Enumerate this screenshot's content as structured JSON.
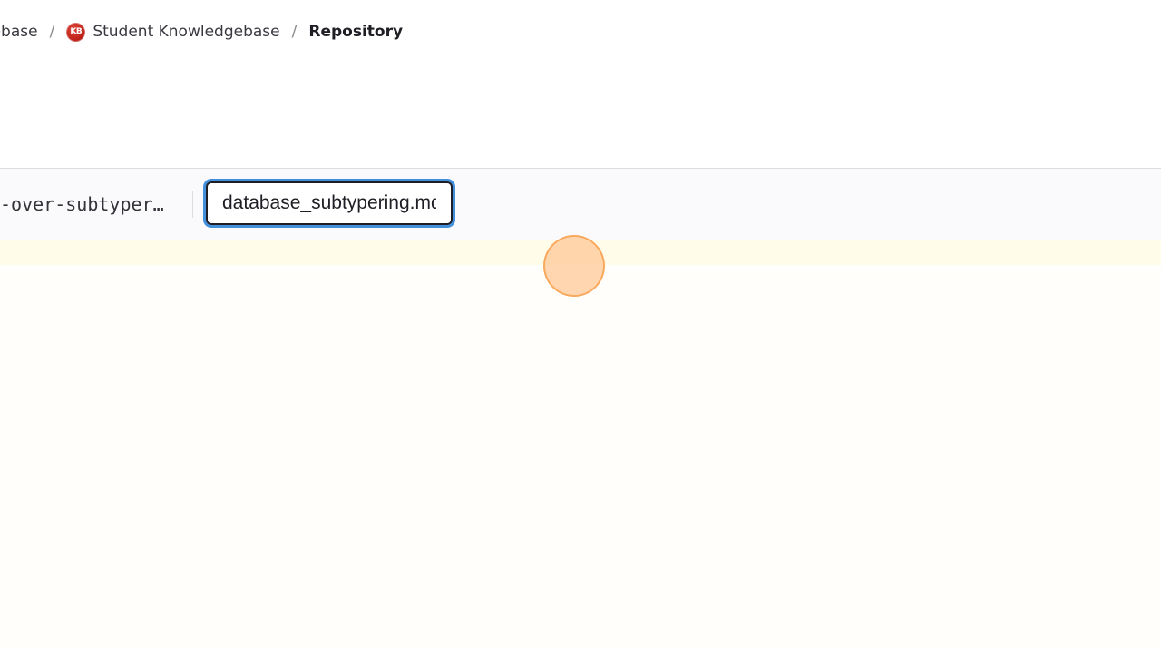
{
  "breadcrumb": {
    "items": [
      {
        "label": "dgebase"
      },
      {
        "label": "Student Knowledgebase",
        "avatar_text": "KB"
      },
      {
        "label": "Repository"
      }
    ],
    "separator": "/"
  },
  "toolbar": {
    "branch_name": "-over-subtyper…",
    "filename_value": "database_subtypering.md"
  },
  "colors": {
    "focus_ring": "#428fdc",
    "avatar_red": "#c8281e",
    "editor_line_highlight": "#fffce9",
    "cursor_fill": "#ffc896",
    "cursor_border": "#f8a658"
  }
}
